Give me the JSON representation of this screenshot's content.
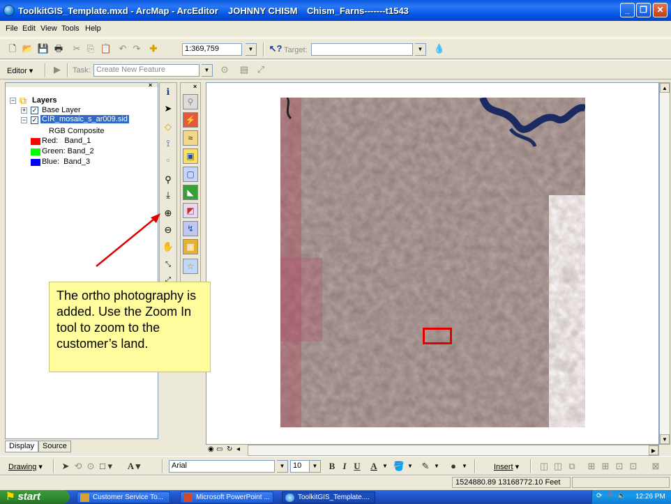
{
  "window": {
    "title": "ToolkitGIS_Template.mxd - ArcMap - ArcEditor",
    "user": "JOHNNY CHISM",
    "doc_tag": "Chism_Farns-------t1543"
  },
  "menu": [
    "File",
    "Edit",
    "View",
    "Tools",
    "Help"
  ],
  "standard_toolbar": {
    "scale": "1:369,759",
    "target_label": "Target:",
    "target_value": ""
  },
  "editor_toolbar": {
    "editor_label": "Editor",
    "task_label": "Task:",
    "task_value": "Create New Feature"
  },
  "toc": {
    "root": "Layers",
    "layers": [
      {
        "name": "Base Layer",
        "checked": true,
        "expanded": false
      },
      {
        "name": "CIR_mosaic_s_ar009.sid",
        "checked": true,
        "expanded": true,
        "selected": true
      }
    ],
    "renderer_label": "RGB Composite",
    "bands": [
      {
        "label": "Red:   Band_1",
        "color": "#ff0000"
      },
      {
        "label": "Green: Band_2",
        "color": "#00ff00"
      },
      {
        "label": "Blue:  Band_3",
        "color": "#0000ff"
      }
    ],
    "tabs": [
      "Display",
      "Source"
    ]
  },
  "tools": [
    "identify-icon",
    "select-elements-icon",
    "select-features-icon",
    "edit-vertex-icon",
    "clear-selection-icon",
    "find-icon",
    "go-to-xy-icon",
    "zoom-in-icon",
    "zoom-out-icon",
    "pan-icon",
    "fixed-zoom-in-icon",
    "fixed-zoom-out-icon"
  ],
  "callout": {
    "text": "The ortho photography is added. Use the Zoom In tool to zoom to the customer’s land."
  },
  "drawing_toolbar": {
    "drawing_label": "Drawing",
    "font": "Arial",
    "size": "10",
    "bold": "B",
    "italic": "I",
    "underline": "U",
    "font_color_letter": "A",
    "insert_label": "Insert"
  },
  "status": {
    "coords": "1524880.89  13168772.10 Feet"
  },
  "taskbar": {
    "start": "start",
    "tasks": [
      "Customer Service To...",
      "Microsoft PowerPoint ...",
      "ToolkitGIS_Template...."
    ],
    "clock": "12:26 PM"
  },
  "colors": {
    "callout_bg": "#fffc9e",
    "arrow": "#e00000",
    "selection_rect": "#e00000",
    "title_bar": "#0a5ae0"
  }
}
